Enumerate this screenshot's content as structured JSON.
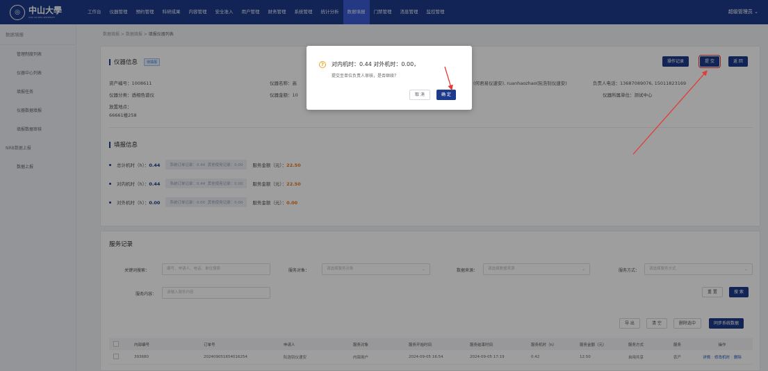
{
  "header": {
    "logo_text": "中山大學",
    "logo_subtext": "SUN YAT-SEN UNIVERSITY",
    "nav": [
      "工作台",
      "仪器管理",
      "预约管理",
      "科研成果",
      "内容管理",
      "安全准入",
      "用户管理",
      "财务管理",
      "系统管理",
      "统计分析",
      "数据填报",
      "门禁管理",
      "消息管理",
      "监控管理"
    ],
    "active_nav_index": 10,
    "user": "超级管理员"
  },
  "sidebar": {
    "title": "数据填报",
    "items": [
      "管理制度列表",
      "仪器中心列表",
      "填报任务",
      "仪器数据填报",
      "填报数据审核"
    ],
    "group": "NRB数据上报",
    "group_items": [
      "数据上报"
    ]
  },
  "breadcrumb": [
    "数据填报",
    "数据填报",
    "填报仪器列表"
  ],
  "instrument": {
    "section_title": "仪器信息",
    "status_tag": "待填报",
    "asset_no": "资产编号：1008611",
    "name_prefix": "仪器名称：高",
    "category": "仪器分类：透相色谱仪",
    "amount_prefix": "仪器金额：10",
    "location_label": "放置地点：",
    "location_value": "66661楼258",
    "manager_partial": "(何君易仪速安), ruanhaozhao(阮浩钊仪速安)",
    "phone": "负责人电话：13687089076, 15011823169",
    "unit": "仪器所属单位：测试中心",
    "buttons": {
      "op_log": "操作记录",
      "submit": "提 交",
      "back": "返 回"
    }
  },
  "report": {
    "section_title": "填报信息",
    "rows": [
      {
        "label": "总计机时（h）：",
        "value": "0.44",
        "sys": "系统订单记录：0.44",
        "other": "其他使用记录：0.00",
        "amount_label": "服务金额（元）：",
        "amount": "22.50"
      },
      {
        "label": "对内机时（h）：",
        "value": "0.44",
        "sys": "系统订单记录：0.44",
        "other": "其他使用记录：0.00",
        "amount_label": "服务金额（元）：",
        "amount": "22.50"
      },
      {
        "label": "对外机时（h）：",
        "value": "0.00",
        "sys": "系统订单记录：0.00",
        "other": "其他使用记录：0.00",
        "amount_label": "服务金额（元）：",
        "amount": "0.00"
      }
    ]
  },
  "service": {
    "section_title": "服务记录",
    "keyword_label": "关键词搜索：",
    "keyword_placeholder": "编号、申请人、电话、单位搜索",
    "object_label": "服务对象：",
    "object_placeholder": "请选择服务对象",
    "source_label": "数据来源：",
    "source_placeholder": "请选择数据来源",
    "mode_label": "服务方式：",
    "mode_placeholder": "请选择服务方式",
    "content_label": "服务内容：",
    "content_placeholder": "请输入服务内容",
    "reset": "重 置",
    "search": "搜 索",
    "export": "导 出",
    "clear": "清 空",
    "delete_selected": "删除选中",
    "sync": "同步系统数据",
    "columns": [
      "内部编号",
      "订单号",
      "申请人",
      "服务对象",
      "服务开始时间",
      "服务结束时间",
      "服务机时（h）",
      "服务金额（元）",
      "服务方式",
      "服务",
      "操作"
    ],
    "rows": [
      {
        "id": "393680",
        "order": "202409051654016254",
        "applicant": "阮浩钊仪速安",
        "object": "内部用户",
        "start": "2024-09-05 16:54",
        "end": "2024-09-05 17:19",
        "hours": "0.42",
        "amount": "12.50",
        "mode": "自用共享",
        "svc": "农产",
        "op_detail": "详情",
        "op_edit": "修改机时",
        "op_delete": "删除"
      }
    ]
  },
  "modal": {
    "title": "对内机时：0.44 对外机时：0.00，",
    "message": "提交至单位负责人审核，是否继续？",
    "cancel": "取 消",
    "confirm": "确 定"
  },
  "colors": {
    "nav": "#1e3a8a",
    "primary": "#1e3a8a",
    "warn": "#f0a020",
    "amount": "#e6761e",
    "annotation": "#e53935"
  }
}
